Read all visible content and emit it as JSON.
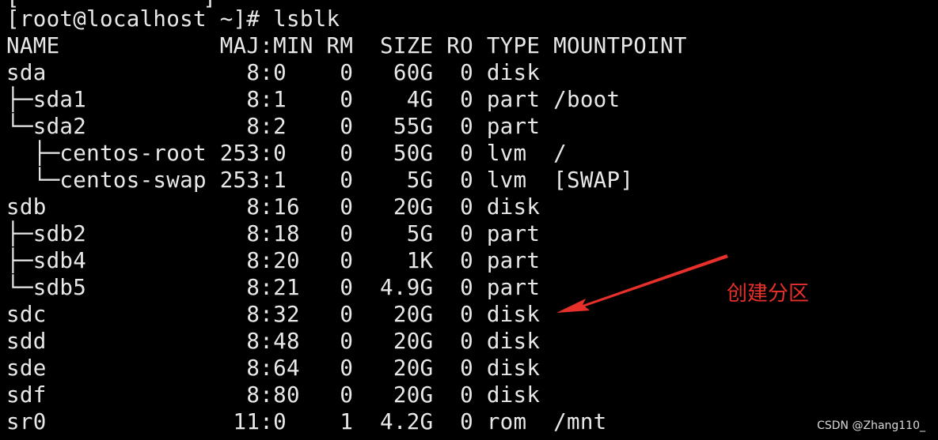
{
  "terminal": {
    "top_partial": "[              ]",
    "prompt": "[root@localhost ~]# lsblk",
    "header": "NAME            MAJ:MIN RM  SIZE RO TYPE MOUNTPOINT",
    "rows": [
      "sda               8:0    0   60G  0 disk",
      "├─sda1            8:1    0    4G  0 part /boot",
      "└─sda2            8:2    0   55G  0 part",
      "  ├─centos-root 253:0    0   50G  0 lvm  /",
      "  └─centos-swap 253:1    0    5G  0 lvm  [SWAP]",
      "sdb               8:16   0   20G  0 disk",
      "├─sdb2            8:18   0    5G  0 part",
      "├─sdb4            8:20   0    1K  0 part",
      "└─sdb5            8:21   0  4.9G  0 part",
      "sdc               8:32   0   20G  0 disk",
      "sdd               8:48   0   20G  0 disk",
      "sde               8:64   0   20G  0 disk",
      "sdf               8:80   0   20G  0 disk",
      "sr0              11:0    1  4.2G  0 rom  /mnt"
    ]
  },
  "annotation": {
    "label": "创建分区",
    "color": "#e8302a"
  },
  "watermark": "CSDN @Zhang110_"
}
